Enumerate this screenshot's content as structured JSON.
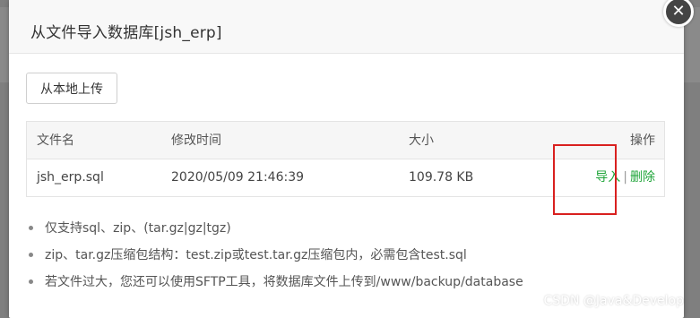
{
  "dialog": {
    "title": "从文件导入数据库[jsh_erp]",
    "close_symbol": "✕"
  },
  "toolbar": {
    "upload_label": "从本地上传"
  },
  "table": {
    "columns": {
      "name": "文件名",
      "time": "修改时间",
      "size": "大小",
      "operation": "操作"
    },
    "rows": [
      {
        "name": "jsh_erp.sql",
        "time": "2020/05/09 21:46:39",
        "size": "109.78 KB",
        "import_label": "导入",
        "separator": "|",
        "delete_label": "删除"
      }
    ]
  },
  "notes": [
    "仅支持sql、zip、(tar.gz|gz|tgz)",
    "zip、tar.gz压缩包结构：test.zip或test.tar.gz压缩包内，必需包含test.sql",
    "若文件过大，您还可以使用SFTP工具，将数据库文件上传到/www/backup/database"
  ],
  "watermark": "CSDN @Java&Develop",
  "colors": {
    "accent": "#20a53a",
    "highlight": "#d9201f",
    "overlay": "#7f7f7f"
  }
}
